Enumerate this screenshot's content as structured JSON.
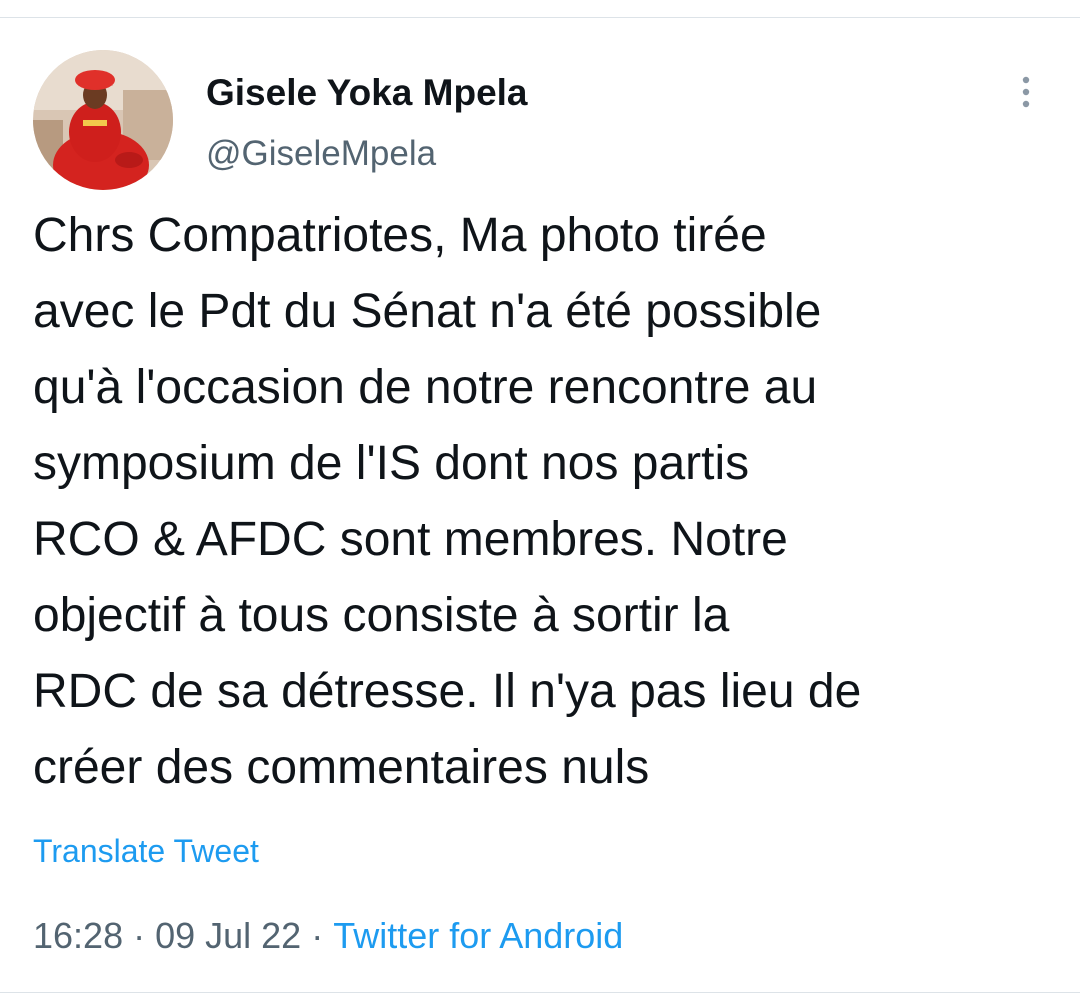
{
  "tweet": {
    "author": {
      "display_name": "Gisele Yoka Mpela",
      "handle": "@GiseleMpela",
      "avatar_icon": "profile-photo"
    },
    "text": "Chrs Compatriotes, Ma photo tirée\navec le Pdt du Sénat n'a été possible\nqu'à l'occasion de notre rencontre au\nsymposium de l'IS dont nos partis\nRCO & AFDC sont membres. Notre\nobjectif à tous consiste à sortir la\nRDC de sa détresse. Il n'ya pas lieu de\ncréer des commentaires nuls",
    "translate_label": "Translate Tweet",
    "time": "16:28",
    "date": "09 Jul 22",
    "separator": "·",
    "source": "Twitter for Android",
    "more_icon": "more-vertical-icon"
  },
  "colors": {
    "text_primary": "#0f1419",
    "text_secondary": "#536471",
    "accent": "#1d9bf0",
    "divider": "#dde3e8"
  }
}
